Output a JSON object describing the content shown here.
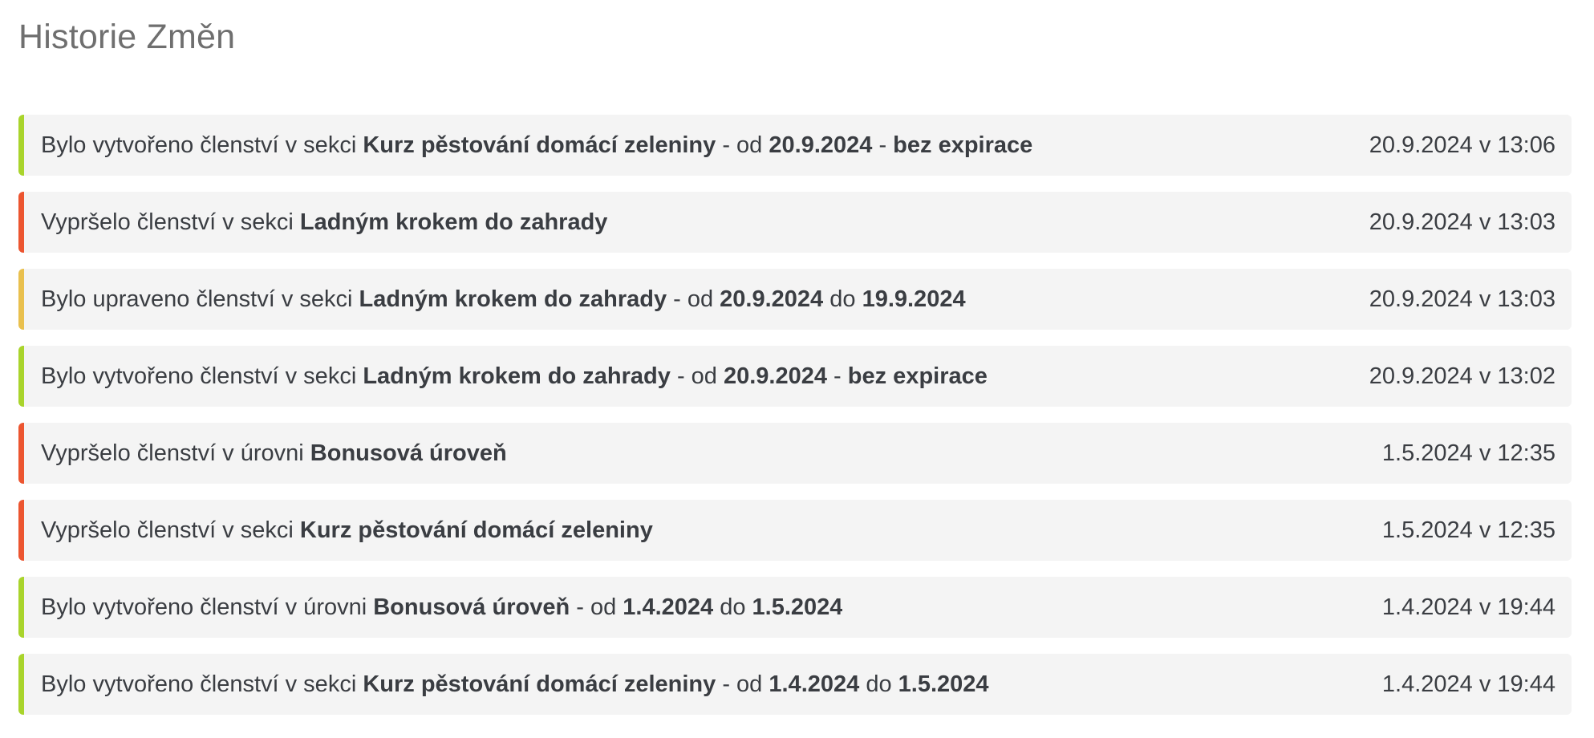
{
  "page": {
    "title": "Historie Změn"
  },
  "colors": {
    "created": "#a9d42c",
    "expired": "#ec5530",
    "updated": "#e9c04e"
  },
  "history": [
    {
      "status": "created",
      "parts": [
        {
          "text": "Bylo vytvořeno členství v sekci ",
          "bold": false
        },
        {
          "text": "Kurz pěstování domácí zeleniny",
          "bold": true
        },
        {
          "text": " - od ",
          "bold": false
        },
        {
          "text": "20.9.2024",
          "bold": true
        },
        {
          "text": " - ",
          "bold": false
        },
        {
          "text": "bez expirace",
          "bold": true
        }
      ],
      "date": "20.9.2024 v 13:06"
    },
    {
      "status": "expired",
      "parts": [
        {
          "text": "Vypršelo členství v sekci ",
          "bold": false
        },
        {
          "text": "Ladným krokem do zahrady",
          "bold": true
        }
      ],
      "date": "20.9.2024 v 13:03"
    },
    {
      "status": "updated",
      "parts": [
        {
          "text": "Bylo upraveno členství v sekci ",
          "bold": false
        },
        {
          "text": "Ladným krokem do zahrady",
          "bold": true
        },
        {
          "text": " - od ",
          "bold": false
        },
        {
          "text": "20.9.2024",
          "bold": true
        },
        {
          "text": " do ",
          "bold": false
        },
        {
          "text": "19.9.2024",
          "bold": true
        }
      ],
      "date": "20.9.2024 v 13:03"
    },
    {
      "status": "created",
      "parts": [
        {
          "text": "Bylo vytvořeno členství v sekci ",
          "bold": false
        },
        {
          "text": "Ladným krokem do zahrady",
          "bold": true
        },
        {
          "text": " - od ",
          "bold": false
        },
        {
          "text": "20.9.2024",
          "bold": true
        },
        {
          "text": " - ",
          "bold": false
        },
        {
          "text": "bez expirace",
          "bold": true
        }
      ],
      "date": "20.9.2024 v 13:02"
    },
    {
      "status": "expired",
      "parts": [
        {
          "text": "Vypršelo členství v úrovni ",
          "bold": false
        },
        {
          "text": "Bonusová úroveň",
          "bold": true
        }
      ],
      "date": "1.5.2024 v 12:35"
    },
    {
      "status": "expired",
      "parts": [
        {
          "text": "Vypršelo členství v sekci ",
          "bold": false
        },
        {
          "text": "Kurz pěstování domácí zeleniny",
          "bold": true
        }
      ],
      "date": "1.5.2024 v 12:35"
    },
    {
      "status": "created",
      "parts": [
        {
          "text": "Bylo vytvořeno členství v úrovni ",
          "bold": false
        },
        {
          "text": "Bonusová úroveň",
          "bold": true
        },
        {
          "text": " - od ",
          "bold": false
        },
        {
          "text": "1.4.2024",
          "bold": true
        },
        {
          "text": " do ",
          "bold": false
        },
        {
          "text": "1.5.2024",
          "bold": true
        }
      ],
      "date": "1.4.2024 v 19:44"
    },
    {
      "status": "created",
      "parts": [
        {
          "text": "Bylo vytvořeno členství v sekci ",
          "bold": false
        },
        {
          "text": "Kurz pěstování domácí zeleniny",
          "bold": true
        },
        {
          "text": " - od ",
          "bold": false
        },
        {
          "text": "1.4.2024",
          "bold": true
        },
        {
          "text": " do ",
          "bold": false
        },
        {
          "text": "1.5.2024",
          "bold": true
        }
      ],
      "date": "1.4.2024 v 19:44"
    }
  ]
}
